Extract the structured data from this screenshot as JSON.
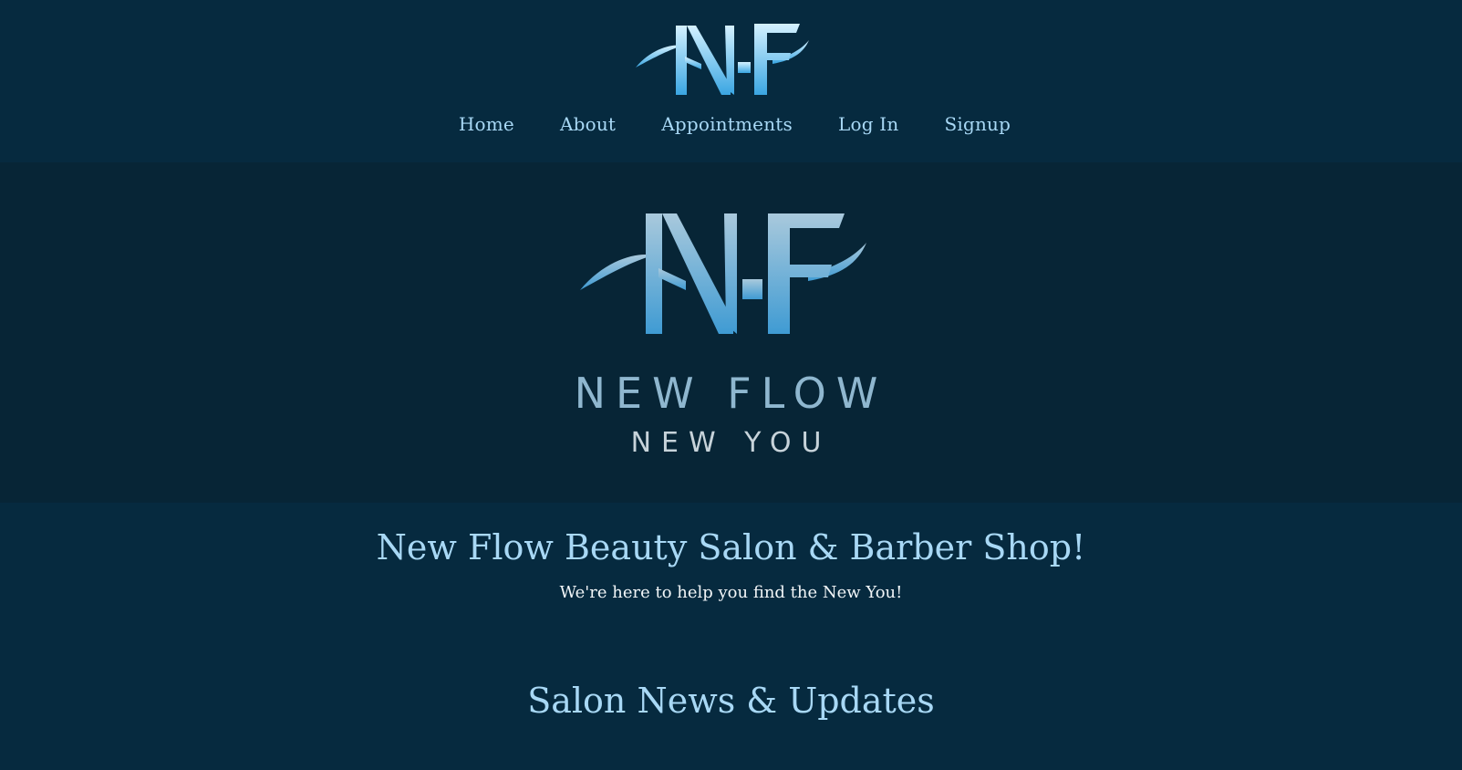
{
  "header": {
    "logo_icon": "nf-monogram-logo",
    "nav": [
      {
        "label": "Home"
      },
      {
        "label": "About"
      },
      {
        "label": "Appointments"
      },
      {
        "label": "Log In"
      },
      {
        "label": "Signup"
      }
    ]
  },
  "hero": {
    "logo_icon": "nf-monogram-logo",
    "line1": "NEW FLOW",
    "line2": "NEW YOU"
  },
  "welcome": {
    "title": "New Flow Beauty Salon & Barber Shop!",
    "subtitle": "We're here to help you find the New You!"
  },
  "news": {
    "title": "Salon News & Updates"
  },
  "colors": {
    "page_bg": "#062a3f",
    "hero_bg": "#072536",
    "accent": "#a8d8f5",
    "logo_gradient_top": "#cfeefe",
    "logo_gradient_bottom": "#3aa6e2"
  }
}
